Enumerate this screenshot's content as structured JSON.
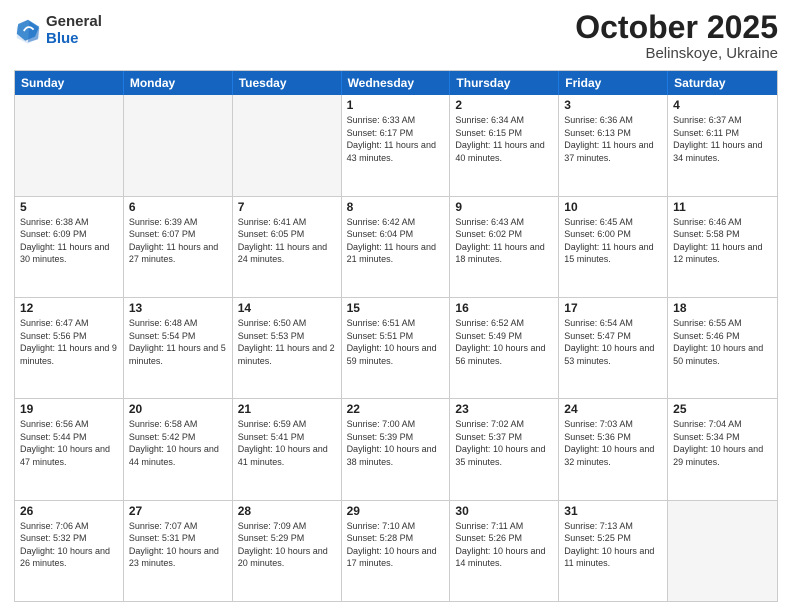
{
  "header": {
    "logo": {
      "general": "General",
      "blue": "Blue"
    },
    "title": "October 2025",
    "subtitle": "Belinskoye, Ukraine"
  },
  "calendar": {
    "weekdays": [
      "Sunday",
      "Monday",
      "Tuesday",
      "Wednesday",
      "Thursday",
      "Friday",
      "Saturday"
    ],
    "rows": [
      [
        {
          "day": "",
          "info": ""
        },
        {
          "day": "",
          "info": ""
        },
        {
          "day": "",
          "info": ""
        },
        {
          "day": "1",
          "info": "Sunrise: 6:33 AM\nSunset: 6:17 PM\nDaylight: 11 hours and 43 minutes."
        },
        {
          "day": "2",
          "info": "Sunrise: 6:34 AM\nSunset: 6:15 PM\nDaylight: 11 hours and 40 minutes."
        },
        {
          "day": "3",
          "info": "Sunrise: 6:36 AM\nSunset: 6:13 PM\nDaylight: 11 hours and 37 minutes."
        },
        {
          "day": "4",
          "info": "Sunrise: 6:37 AM\nSunset: 6:11 PM\nDaylight: 11 hours and 34 minutes."
        }
      ],
      [
        {
          "day": "5",
          "info": "Sunrise: 6:38 AM\nSunset: 6:09 PM\nDaylight: 11 hours and 30 minutes."
        },
        {
          "day": "6",
          "info": "Sunrise: 6:39 AM\nSunset: 6:07 PM\nDaylight: 11 hours and 27 minutes."
        },
        {
          "day": "7",
          "info": "Sunrise: 6:41 AM\nSunset: 6:05 PM\nDaylight: 11 hours and 24 minutes."
        },
        {
          "day": "8",
          "info": "Sunrise: 6:42 AM\nSunset: 6:04 PM\nDaylight: 11 hours and 21 minutes."
        },
        {
          "day": "9",
          "info": "Sunrise: 6:43 AM\nSunset: 6:02 PM\nDaylight: 11 hours and 18 minutes."
        },
        {
          "day": "10",
          "info": "Sunrise: 6:45 AM\nSunset: 6:00 PM\nDaylight: 11 hours and 15 minutes."
        },
        {
          "day": "11",
          "info": "Sunrise: 6:46 AM\nSunset: 5:58 PM\nDaylight: 11 hours and 12 minutes."
        }
      ],
      [
        {
          "day": "12",
          "info": "Sunrise: 6:47 AM\nSunset: 5:56 PM\nDaylight: 11 hours and 9 minutes."
        },
        {
          "day": "13",
          "info": "Sunrise: 6:48 AM\nSunset: 5:54 PM\nDaylight: 11 hours and 5 minutes."
        },
        {
          "day": "14",
          "info": "Sunrise: 6:50 AM\nSunset: 5:53 PM\nDaylight: 11 hours and 2 minutes."
        },
        {
          "day": "15",
          "info": "Sunrise: 6:51 AM\nSunset: 5:51 PM\nDaylight: 10 hours and 59 minutes."
        },
        {
          "day": "16",
          "info": "Sunrise: 6:52 AM\nSunset: 5:49 PM\nDaylight: 10 hours and 56 minutes."
        },
        {
          "day": "17",
          "info": "Sunrise: 6:54 AM\nSunset: 5:47 PM\nDaylight: 10 hours and 53 minutes."
        },
        {
          "day": "18",
          "info": "Sunrise: 6:55 AM\nSunset: 5:46 PM\nDaylight: 10 hours and 50 minutes."
        }
      ],
      [
        {
          "day": "19",
          "info": "Sunrise: 6:56 AM\nSunset: 5:44 PM\nDaylight: 10 hours and 47 minutes."
        },
        {
          "day": "20",
          "info": "Sunrise: 6:58 AM\nSunset: 5:42 PM\nDaylight: 10 hours and 44 minutes."
        },
        {
          "day": "21",
          "info": "Sunrise: 6:59 AM\nSunset: 5:41 PM\nDaylight: 10 hours and 41 minutes."
        },
        {
          "day": "22",
          "info": "Sunrise: 7:00 AM\nSunset: 5:39 PM\nDaylight: 10 hours and 38 minutes."
        },
        {
          "day": "23",
          "info": "Sunrise: 7:02 AM\nSunset: 5:37 PM\nDaylight: 10 hours and 35 minutes."
        },
        {
          "day": "24",
          "info": "Sunrise: 7:03 AM\nSunset: 5:36 PM\nDaylight: 10 hours and 32 minutes."
        },
        {
          "day": "25",
          "info": "Sunrise: 7:04 AM\nSunset: 5:34 PM\nDaylight: 10 hours and 29 minutes."
        }
      ],
      [
        {
          "day": "26",
          "info": "Sunrise: 7:06 AM\nSunset: 5:32 PM\nDaylight: 10 hours and 26 minutes."
        },
        {
          "day": "27",
          "info": "Sunrise: 7:07 AM\nSunset: 5:31 PM\nDaylight: 10 hours and 23 minutes."
        },
        {
          "day": "28",
          "info": "Sunrise: 7:09 AM\nSunset: 5:29 PM\nDaylight: 10 hours and 20 minutes."
        },
        {
          "day": "29",
          "info": "Sunrise: 7:10 AM\nSunset: 5:28 PM\nDaylight: 10 hours and 17 minutes."
        },
        {
          "day": "30",
          "info": "Sunrise: 7:11 AM\nSunset: 5:26 PM\nDaylight: 10 hours and 14 minutes."
        },
        {
          "day": "31",
          "info": "Sunrise: 7:13 AM\nSunset: 5:25 PM\nDaylight: 10 hours and 11 minutes."
        },
        {
          "day": "",
          "info": ""
        }
      ]
    ]
  }
}
